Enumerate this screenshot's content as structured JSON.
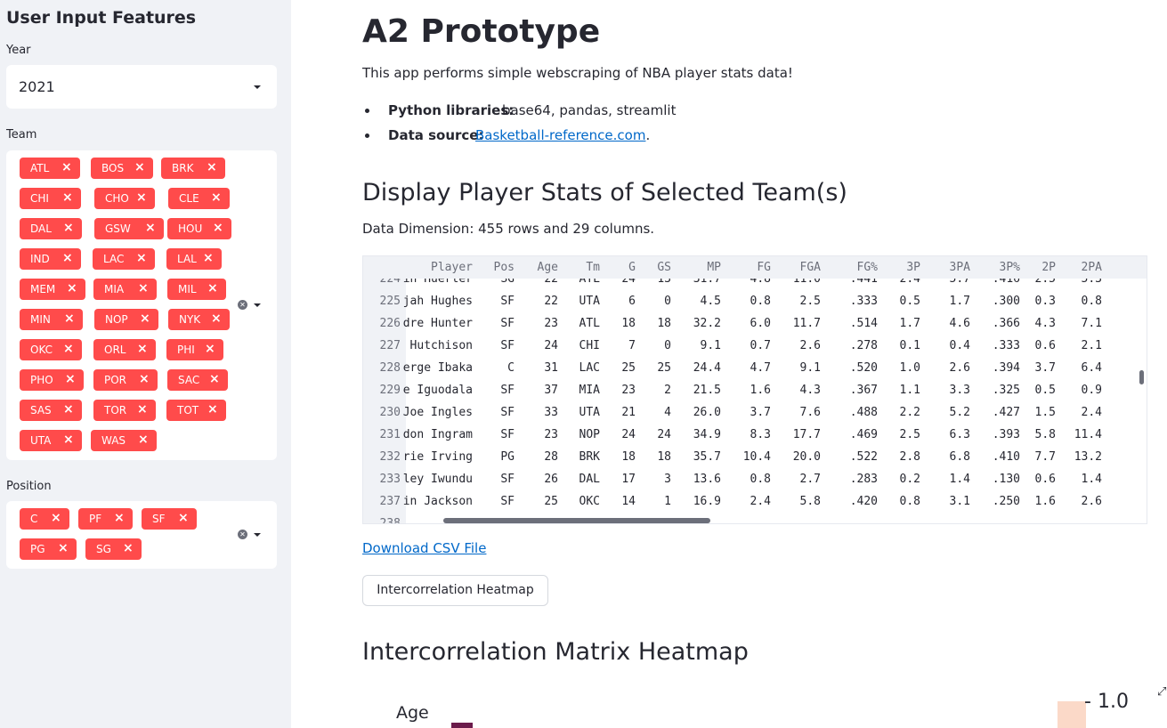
{
  "sidebar": {
    "title": "User Input Features",
    "year_label": "Year",
    "year_value": "2021",
    "team_label": "Team",
    "teams": [
      "ATL",
      "BOS",
      "BRK",
      "CHI",
      "CHO",
      "CLE",
      "DAL",
      "GSW",
      "HOU",
      "IND",
      "LAC",
      "LAL",
      "MEM",
      "MIA",
      "MIL",
      "MIN",
      "NOP",
      "NYK",
      "OKC",
      "ORL",
      "PHI",
      "PHO",
      "POR",
      "SAC",
      "SAS",
      "TOR",
      "TOT",
      "UTA",
      "WAS"
    ],
    "position_label": "Position",
    "positions": [
      "C",
      "PF",
      "SF",
      "PG",
      "SG"
    ],
    "tag_color": "#ff4b4b"
  },
  "main": {
    "title": "A2 Prototype",
    "intro": "This app performs simple webscraping of NBA player stats data!",
    "bullets": [
      {
        "label": "Python libraries:",
        "value": "base64, pandas, streamlit"
      },
      {
        "label": "Data source:",
        "link": "Basketball-reference.com",
        "suffix": "."
      }
    ],
    "section_title": "Display Player Stats of Selected Team(s)",
    "dimensions": "Data Dimension: 455 rows and 29 columns.",
    "download_link": "Download CSV File",
    "heatmap_button": "Intercorrelation Heatmap",
    "heatmap_title": "Intercorrelation Matrix Heatmap",
    "heatmap_row_label": "Age",
    "heatmap_scale_tick": "1.0",
    "heatmap_scale_dash": "-"
  },
  "table": {
    "columns": [
      "Player",
      "Pos",
      "Age",
      "Tm",
      "G",
      "GS",
      "MP",
      "FG",
      "FGA",
      "FG%",
      "3P",
      "3PA",
      "3P%",
      "2P",
      "2PA"
    ],
    "top_partial": {
      "index": "224",
      "cells": [
        "in Huerter",
        "SG",
        "22",
        "ATL",
        "24",
        "13",
        "31.7",
        "4.8",
        "11.0",
        ".441",
        "2.4",
        "5.7",
        ".416",
        "2.5",
        "5.3"
      ]
    },
    "rows": [
      {
        "index": "225",
        "cells": [
          "jah Hughes",
          "SF",
          "22",
          "UTA",
          "6",
          "0",
          "4.5",
          "0.8",
          "2.5",
          ".333",
          "0.5",
          "1.7",
          ".300",
          "0.3",
          "0.8"
        ]
      },
      {
        "index": "226",
        "cells": [
          "dre Hunter",
          "SF",
          "23",
          "ATL",
          "18",
          "18",
          "32.2",
          "6.0",
          "11.7",
          ".514",
          "1.7",
          "4.6",
          ".366",
          "4.3",
          "7.1"
        ]
      },
      {
        "index": "227",
        "cells": [
          " Hutchison",
          "SF",
          "24",
          "CHI",
          "7",
          "0",
          "9.1",
          "0.7",
          "2.6",
          ".278",
          "0.1",
          "0.4",
          ".333",
          "0.6",
          "2.1"
        ]
      },
      {
        "index": "228",
        "cells": [
          "erge Ibaka",
          "C",
          "31",
          "LAC",
          "25",
          "25",
          "24.4",
          "4.7",
          "9.1",
          ".520",
          "1.0",
          "2.6",
          ".394",
          "3.7",
          "6.4"
        ]
      },
      {
        "index": "229",
        "cells": [
          "e Iguodala",
          "SF",
          "37",
          "MIA",
          "23",
          "2",
          "21.5",
          "1.6",
          "4.3",
          ".367",
          "1.1",
          "3.3",
          ".325",
          "0.5",
          "0.9"
        ]
      },
      {
        "index": "230",
        "cells": [
          "Joe Ingles",
          "SF",
          "33",
          "UTA",
          "21",
          "4",
          "26.0",
          "3.7",
          "7.6",
          ".488",
          "2.2",
          "5.2",
          ".427",
          "1.5",
          "2.4"
        ]
      },
      {
        "index": "231",
        "cells": [
          "don Ingram",
          "SF",
          "23",
          "NOP",
          "24",
          "24",
          "34.9",
          "8.3",
          "17.7",
          ".469",
          "2.5",
          "6.3",
          ".393",
          "5.8",
          "11.4"
        ]
      },
      {
        "index": "232",
        "cells": [
          "rie Irving",
          "PG",
          "28",
          "BRK",
          "18",
          "18",
          "35.7",
          "10.4",
          "20.0",
          ".522",
          "2.8",
          "6.8",
          ".410",
          "7.7",
          "13.2"
        ]
      },
      {
        "index": "233",
        "cells": [
          "ley Iwundu",
          "SF",
          "26",
          "DAL",
          "17",
          "3",
          "13.6",
          "0.8",
          "2.7",
          ".283",
          "0.2",
          "1.4",
          ".130",
          "0.6",
          "1.4"
        ]
      },
      {
        "index": "237",
        "cells": [
          "in Jackson",
          "SF",
          "25",
          "OKC",
          "14",
          "1",
          "16.9",
          "2.4",
          "5.8",
          ".420",
          "0.8",
          "3.1",
          ".250",
          "1.6",
          "2.6"
        ]
      }
    ],
    "bottom_partial": {
      "index": "238"
    }
  }
}
